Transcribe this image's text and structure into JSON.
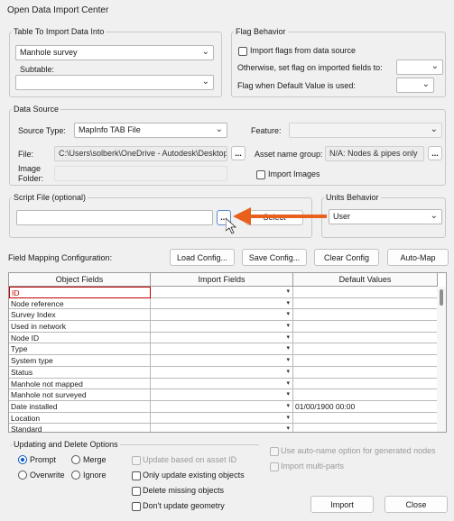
{
  "window": {
    "title": "Open Data Import Center"
  },
  "table_import": {
    "legend": "Table To Import Data Into",
    "table_value": "Manhole survey",
    "subtable_label": "Subtable:",
    "subtable_value": ""
  },
  "flag_behavior": {
    "legend": "Flag Behavior",
    "import_flags_label": "Import flags from data source",
    "otherwise_label": "Otherwise, set flag on imported fields to:",
    "default_label": "Flag when Default Value is used:"
  },
  "data_source": {
    "legend": "Data Source",
    "source_type_label": "Source Type:",
    "source_type_value": "MapInfo TAB File",
    "feature_label": "Feature:",
    "file_label": "File:",
    "file_value": "C:\\Users\\solberk\\OneDrive - Autodesk\\Desktop",
    "browse_label": "...",
    "asset_group_label": "Asset name group:",
    "asset_group_value": "N/A: Nodes & pipes only",
    "asset_browse_label": "...",
    "image_folder_label": "Image\nFolder:",
    "image_folder_line1": "Image",
    "image_folder_line2": "Folder:",
    "import_images_label": "Import Images"
  },
  "script_file": {
    "legend": "Script File (optional)",
    "value": "",
    "browse_label": "...",
    "hidden_button_label": "Select"
  },
  "units_behavior": {
    "legend": "Units Behavior",
    "value": "User"
  },
  "field_mapping": {
    "label": "Field Mapping Configuration:",
    "load_label": "Load Config...",
    "save_label": "Save Config...",
    "clear_label": "Clear Config",
    "automap_label": "Auto-Map",
    "headers": [
      "Object Fields",
      "Import Fields",
      "Default Values"
    ],
    "rows": [
      {
        "field": "ID",
        "import": "",
        "default": ""
      },
      {
        "field": "Node reference",
        "import": "",
        "default": ""
      },
      {
        "field": "Survey Index",
        "import": "",
        "default": ""
      },
      {
        "field": "Used in network",
        "import": "",
        "default": ""
      },
      {
        "field": "Node ID",
        "import": "",
        "default": ""
      },
      {
        "field": "Type",
        "import": "",
        "default": ""
      },
      {
        "field": "System type",
        "import": "",
        "default": ""
      },
      {
        "field": "Status",
        "import": "",
        "default": ""
      },
      {
        "field": "Manhole not mapped",
        "import": "",
        "default": ""
      },
      {
        "field": "Manhole not surveyed",
        "import": "",
        "default": ""
      },
      {
        "field": "Date installed",
        "import": "",
        "default": "01/00/1900 00:00"
      },
      {
        "field": "Location",
        "import": "",
        "default": ""
      },
      {
        "field": "Standard",
        "import": "",
        "default": ""
      }
    ]
  },
  "update_delete": {
    "legend": "Updating and Delete Options",
    "prompt_label": "Prompt",
    "merge_label": "Merge",
    "overwrite_label": "Overwrite",
    "ignore_label": "Ignore",
    "update_asset_label": "Update based on asset ID",
    "only_update_label": "Only update existing objects",
    "delete_missing_label": "Delete missing objects",
    "dont_update_geom_label": "Don't update geometry"
  },
  "options": {
    "auto_name_label": "Use auto-name option for generated nodes",
    "multi_parts_label": "Import multi-parts"
  },
  "actions": {
    "import_label": "Import",
    "close_label": "Close"
  },
  "colors": {
    "annotation_arrow": "#e8601c",
    "required_field": "#c00000"
  }
}
